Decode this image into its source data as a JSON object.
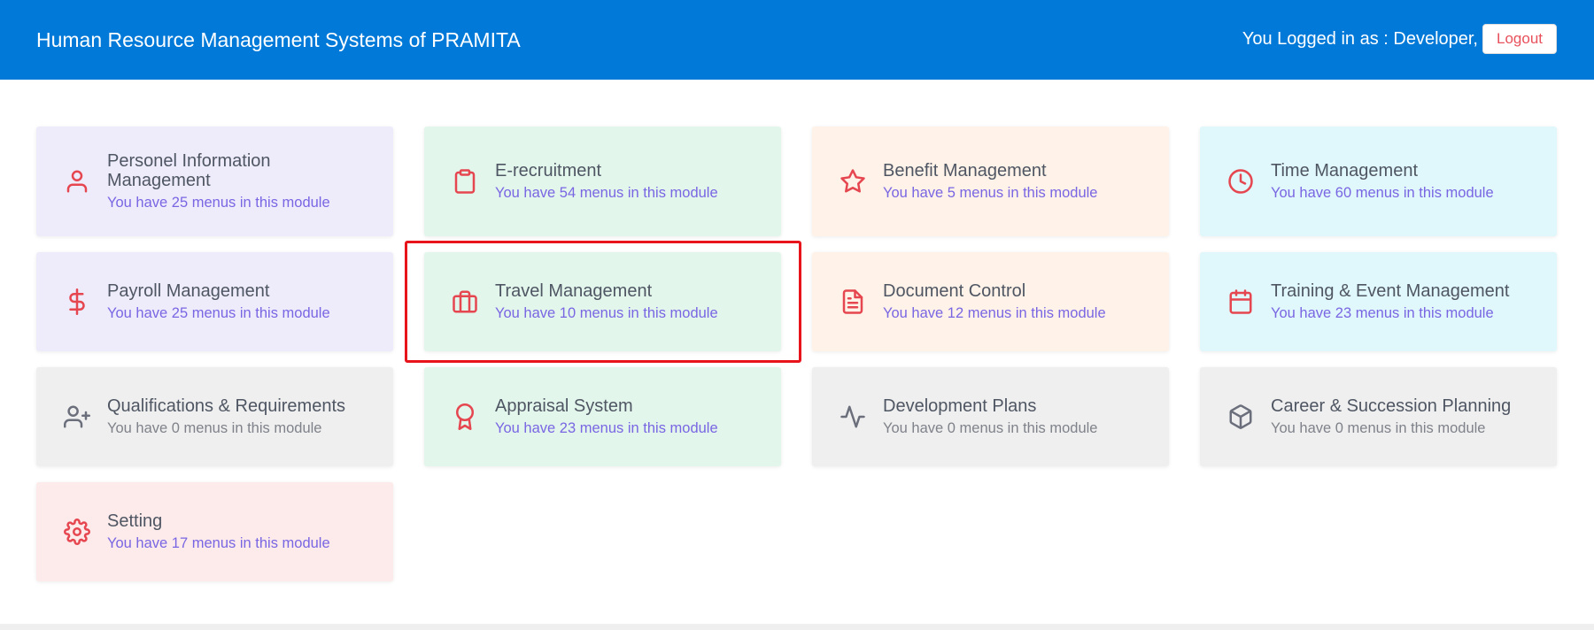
{
  "header": {
    "title": "Human Resource Management Systems of PRAMITA",
    "logged_in_text": "You Logged in as : Developer,",
    "logout_label": "Logout"
  },
  "modules": [
    {
      "name": "Personel Information Management",
      "subtitle": "You have 25 menus in this module",
      "icon": "user-icon",
      "color": "#eeecfb"
    },
    {
      "name": "E-recruitment",
      "subtitle": "You have 54 menus in this module",
      "icon": "clipboard-icon",
      "color": "#e3f6ec"
    },
    {
      "name": "Benefit Management",
      "subtitle": "You have 5 menus in this module",
      "icon": "star-icon",
      "color": "#fff2e8"
    },
    {
      "name": "Time Management",
      "subtitle": "You have 60 menus in this module",
      "icon": "clock-icon",
      "color": "#e0f7fb"
    },
    {
      "name": "Payroll Management",
      "subtitle": "You have 25 menus in this module",
      "icon": "dollar-icon",
      "color": "#eeecfb"
    },
    {
      "name": "Travel Management",
      "subtitle": "You have 10 menus in this module",
      "icon": "briefcase-icon",
      "color": "#e3f6ec"
    },
    {
      "name": "Document Control",
      "subtitle": "You have 12 menus in this module",
      "icon": "file-text-icon",
      "color": "#fff2e8"
    },
    {
      "name": "Training & Event Management",
      "subtitle": "You have 23 menus in this module",
      "icon": "calendar-icon",
      "color": "#e0f7fb"
    },
    {
      "name": "Qualifications & Requirements",
      "subtitle": "You have 0 menus in this module",
      "icon": "user-plus-icon",
      "color": "#efefef"
    },
    {
      "name": "Appraisal System",
      "subtitle": "You have 23 menus in this module",
      "icon": "award-icon",
      "color": "#e3f6ec"
    },
    {
      "name": "Development Plans",
      "subtitle": "You have 0 menus in this module",
      "icon": "activity-icon",
      "color": "#efefef"
    },
    {
      "name": "Career & Succession Planning",
      "subtitle": "You have 0 menus in this module",
      "icon": "box-icon",
      "color": "#efefef"
    },
    {
      "name": "Setting",
      "subtitle": "You have 17 menus in this module",
      "icon": "gear-icon",
      "color": "#fdeaea"
    }
  ],
  "colors": {
    "header_bg": "#0079d8",
    "icon_accent": "#e5464f",
    "subtitle_accent": "#7966e3",
    "highlight_border": "#e8141b"
  }
}
